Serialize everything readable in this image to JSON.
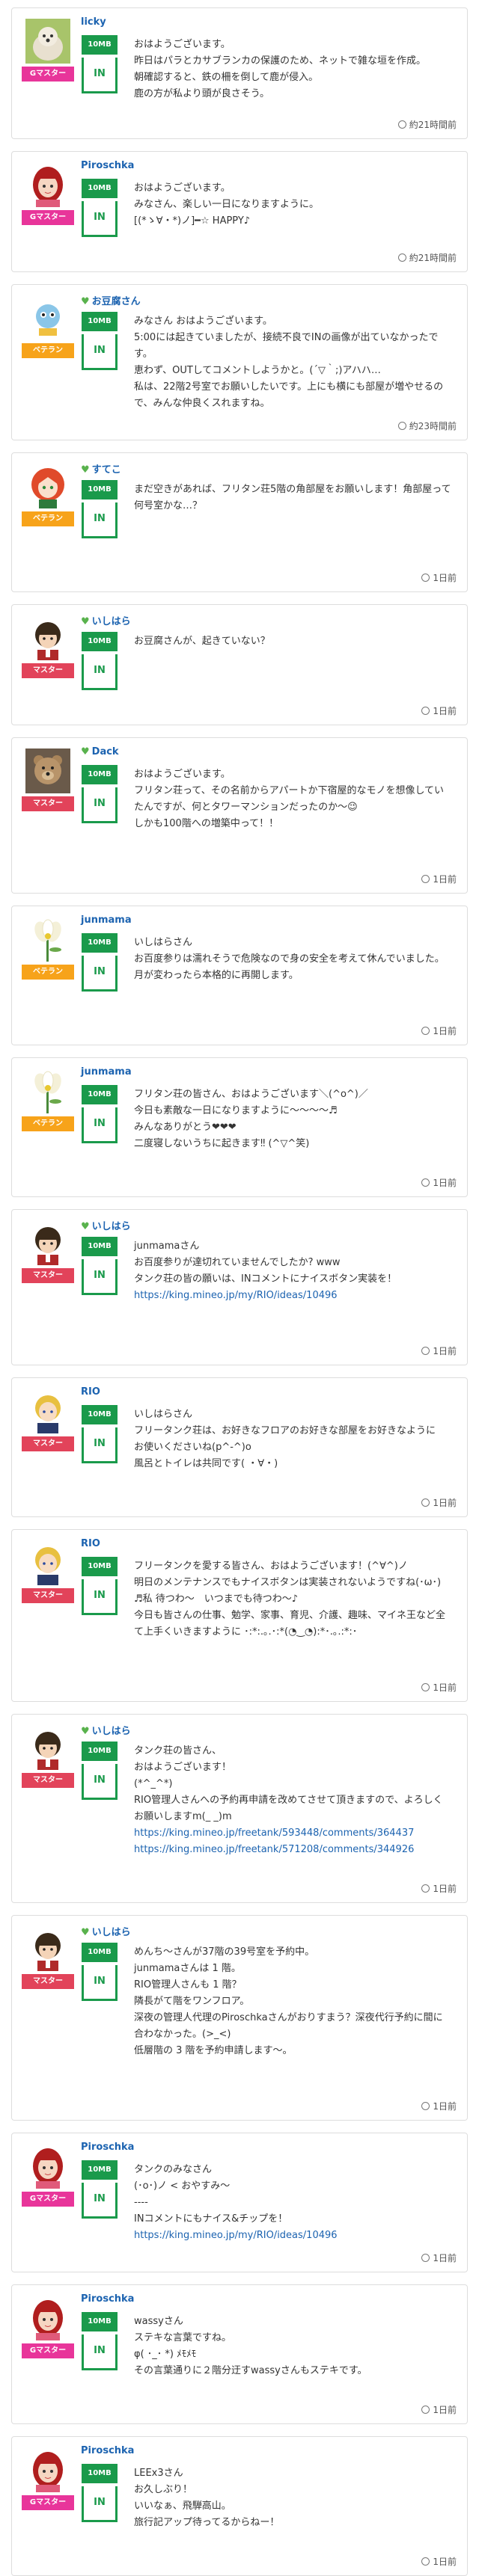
{
  "posts": [
    {
      "user": "licky",
      "badge": "Gマスター",
      "badge_type": "g",
      "plan": "10MB",
      "room": "IN",
      "avatar": "dog-icon",
      "leaf": false,
      "lines": [
        "おはようございます。",
        "昨日はパラとカサブランカの保護のため、ネットで雑な垣を作成。",
        "朝確認すると、鉄の柵を倒して鹿が侵入。",
        "鹿の方が私より頭が良さそう。"
      ],
      "time": "約21時間前"
    },
    {
      "user": "Piroschka",
      "badge": "Gマスター",
      "badge_type": "g",
      "plan": "10MB",
      "room": "IN",
      "avatar": "red-hair-woman-icon",
      "leaf": false,
      "lines": [
        "おはようございます。",
        "みなさん、楽しい一日になりますように。",
        "[(*ゝ∀・*)ノ]━☆ HAPPY♪"
      ],
      "time": "約21時間前"
    },
    {
      "user": "お豆腐さん",
      "badge": "ベテラン",
      "badge_type": "v",
      "plan": "10MB",
      "room": "IN",
      "avatar": "character-icon",
      "leaf": true,
      "lines": [
        "みなさん おはようございます。",
        "5:00には起きていましたが、接続不良でINの画像が出ていなかったです。",
        "恵わず、OUTしてコメントしようかと。(´▽｀;)アハハ…",
        "私は、22階2号室でお願いしたいです。上にも横にも部屋が増やせるので、みんな仲良くスれますね。"
      ],
      "time": "約23時間前"
    },
    {
      "user": "すてこ",
      "badge": "ベテラン",
      "badge_type": "v",
      "plan": "10MB",
      "room": "IN",
      "avatar": "anime-girl-icon",
      "leaf": true,
      "lines": [
        "まだ空きがあれば、フリタン荘5階の角部屋をお願いします！角部屋って何号室かな…？"
      ],
      "time": "1日前"
    },
    {
      "user": "いしはら",
      "badge": "マスター",
      "badge_type": "m",
      "plan": "10MB",
      "room": "IN",
      "avatar": "boy-icon",
      "leaf": true,
      "lines": [
        "お豆腐さんが、起きていない？"
      ],
      "time": "1日前"
    },
    {
      "user": "Dack",
      "badge": "マスター",
      "badge_type": "m",
      "plan": "10MB",
      "room": "IN",
      "avatar": "teddy-bear-icon",
      "leaf": true,
      "lines": [
        "おはようございます。",
        "フリタン荘って、その名前からアパートか下宿屋的なモノを想像していたんですが、何とタワーマンションだったのか〜😉",
        "しかも100階への増築中って！！"
      ],
      "time": "1日前"
    },
    {
      "user": "junmama",
      "badge": "ベテラン",
      "badge_type": "v",
      "plan": "10MB",
      "room": "IN",
      "avatar": "flower-icon",
      "leaf": false,
      "lines": [
        "いしはらさん",
        "お百度参りは濡れそうで危険なので身の安全を考えて休んでいました。",
        "月が変わったら本格的に再開します。"
      ],
      "time": "1日前"
    },
    {
      "user": "junmama",
      "badge": "ベテラン",
      "badge_type": "v",
      "plan": "10MB",
      "room": "IN",
      "avatar": "flower-icon",
      "leaf": false,
      "lines": [
        "フリタン荘の皆さん、おはようございます＼(^o^)／",
        "今日も素敵な一日になりますように〜〜〜〜♬",
        "みんなありがとう❤❤❤",
        "二度寝しないうちに起きます‼ (^▽^笑)"
      ],
      "time": "1日前"
    },
    {
      "user": "いしはら",
      "badge": "マスター",
      "badge_type": "m",
      "plan": "10MB",
      "room": "IN",
      "avatar": "boy-icon",
      "leaf": true,
      "lines": [
        "junmamaさん",
        "お百度参りが達切れていませんでしたか? www",
        "タンク荘の皆の願いは、INコメントにナイスボタン実装を！",
        "https://king.mineo.jp/my/RIO/ideas/10496"
      ],
      "time": "1日前"
    },
    {
      "user": "RIO",
      "badge": "マスター",
      "badge_type": "m",
      "plan": "10MB",
      "room": "IN",
      "avatar": "blonde-boy-icon",
      "leaf": false,
      "lines": [
        "いしはらさん",
        "フリータンク荘は、お好きなフロアのお好きな部屋をお好きなように",
        "お使いくださいね(p^-^)o",
        "風呂とトイレは共同です( ・∀・)"
      ],
      "time": "1日前"
    },
    {
      "user": "RIO",
      "badge": "マスター",
      "badge_type": "m",
      "plan": "10MB",
      "room": "IN",
      "avatar": "blonde-boy-icon",
      "leaf": false,
      "lines": [
        "フリータンクを愛する皆さん、おはようございます！(^∀^)ノ",
        "明日のメンテナンスでもナイスボタンは実装されないようですね(･ω･)",
        "♬私 待つわ〜　いつまでも待つわ〜♪",
        "今日も皆さんの仕事、勉学、家事、育児、介護、趣味、マイネ王など全て上手くいきますように ･:*:.｡.･:*(◔‿◔):*･.｡.:*:･"
      ],
      "time": "1日前"
    },
    {
      "user": "いしはら",
      "badge": "マスター",
      "badge_type": "m",
      "plan": "10MB",
      "room": "IN",
      "avatar": "boy-icon",
      "leaf": true,
      "lines": [
        "タンク荘の皆さん、",
        "おはようございます！",
        "(*^_^*)",
        "RIO管理人さんへの予約再申請を改めてさせて頂きますので、よろしくお願いしますm(_ _)m",
        "https://king.mineo.jp/freetank/593448/comments/364437",
        "https://king.mineo.jp/freetank/571208/comments/344926"
      ],
      "time": "1日前"
    },
    {
      "user": "いしはら",
      "badge": "マスター",
      "badge_type": "m",
      "plan": "10MB",
      "room": "IN",
      "avatar": "boy-icon",
      "leaf": true,
      "lines": [
        "めんち〜さんが37階の39号室を予約中。",
        "junmamaさんは 1 階。",
        "RIO管理人さんも 1 階？",
        "隣長がて階をワンフロア。",
        "深夜の管理人代理のPiroschkaさんがおりすまう？深夜代行予約に間に合わなかった。(>_<)",
        "低層階の 3 階を予約申請します〜。"
      ],
      "time": "1日前"
    },
    {
      "user": "Piroschka",
      "badge": "Gマスター",
      "badge_type": "g",
      "plan": "10MB",
      "room": "IN",
      "avatar": "red-hair-woman-icon",
      "leaf": false,
      "lines": [
        "タンクのみなさん",
        "(･o･)ノ < おやすみ〜",
        "----",
        "INコメントにもナイス&チップを！",
        "https://king.mineo.jp/my/RIO/ideas/10496"
      ],
      "time": "1日前"
    },
    {
      "user": "Piroschka",
      "badge": "Gマスター",
      "badge_type": "g",
      "plan": "10MB",
      "room": "IN",
      "avatar": "red-hair-woman-icon",
      "leaf": false,
      "lines": [
        "wassyさん",
        "ステキな言葉ですね。",
        "φ( ･_･ *) ﾒﾓﾒﾓ",
        "その言葉通りに２階分迂すwassyさんもステキです。"
      ],
      "time": "1日前"
    },
    {
      "user": "Piroschka",
      "badge": "Gマスター",
      "badge_type": "g",
      "plan": "10MB",
      "room": "IN",
      "avatar": "red-hair-woman-icon",
      "leaf": false,
      "lines": [
        "LEEx3さん",
        "お久しぶり！",
        "いいなぁ、飛騨高山。",
        "旅行記アップ待ってるからねー！"
      ],
      "time": "1日前"
    }
  ]
}
